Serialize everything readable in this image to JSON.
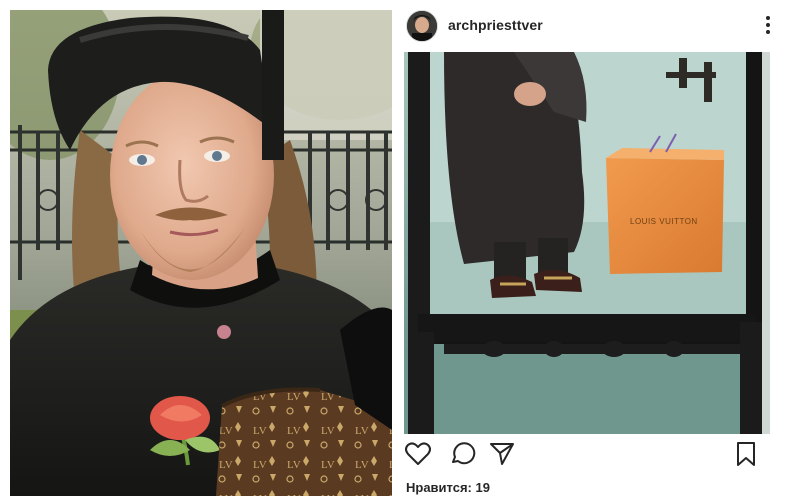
{
  "post": {
    "username": "archpriesttver",
    "likes_text": "Нравится: 19",
    "bag_brand": "LOUIS VUITTON"
  },
  "icons": {
    "avatar": "profile-avatar",
    "more": "more-options-icon",
    "like": "heart-icon",
    "comment": "comment-bubble-icon",
    "share": "paper-plane-icon",
    "save": "bookmark-icon"
  },
  "colors": {
    "text": "#262626",
    "bag_orange": "#e88a3a"
  }
}
